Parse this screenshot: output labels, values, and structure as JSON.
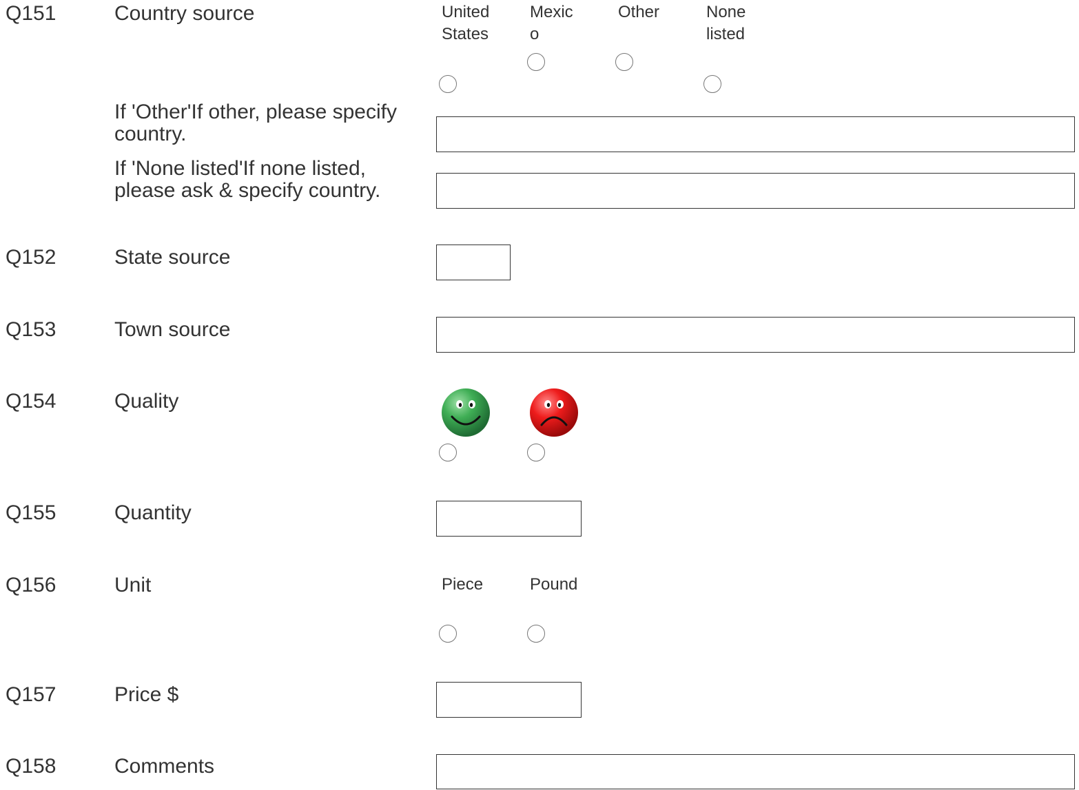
{
  "questions": [
    {
      "id": "Q151",
      "label": "Country source",
      "options": [
        "United States",
        "Mexico",
        "Other",
        "None listed"
      ],
      "subfields": [
        {
          "label": "If 'Other'If other, please specify country.",
          "value": ""
        },
        {
          "label": "If 'None listed'If none listed, please ask & specify country.",
          "value": ""
        }
      ]
    },
    {
      "id": "Q152",
      "label": "State source",
      "value": ""
    },
    {
      "id": "Q153",
      "label": "Town source",
      "value": ""
    },
    {
      "id": "Q154",
      "label": "Quality",
      "options": [
        "happy-face-icon",
        "sad-face-icon"
      ]
    },
    {
      "id": "Q155",
      "label": "Quantity",
      "value": ""
    },
    {
      "id": "Q156",
      "label": "Unit",
      "options": [
        "Piece",
        "Pound"
      ]
    },
    {
      "id": "Q157",
      "label": "Price $",
      "value": ""
    },
    {
      "id": "Q158",
      "label": "Comments",
      "value": ""
    }
  ],
  "colors": {
    "text": "#333333",
    "happy_face": "#3a9a4f",
    "sad_face": "#e41b1b"
  }
}
